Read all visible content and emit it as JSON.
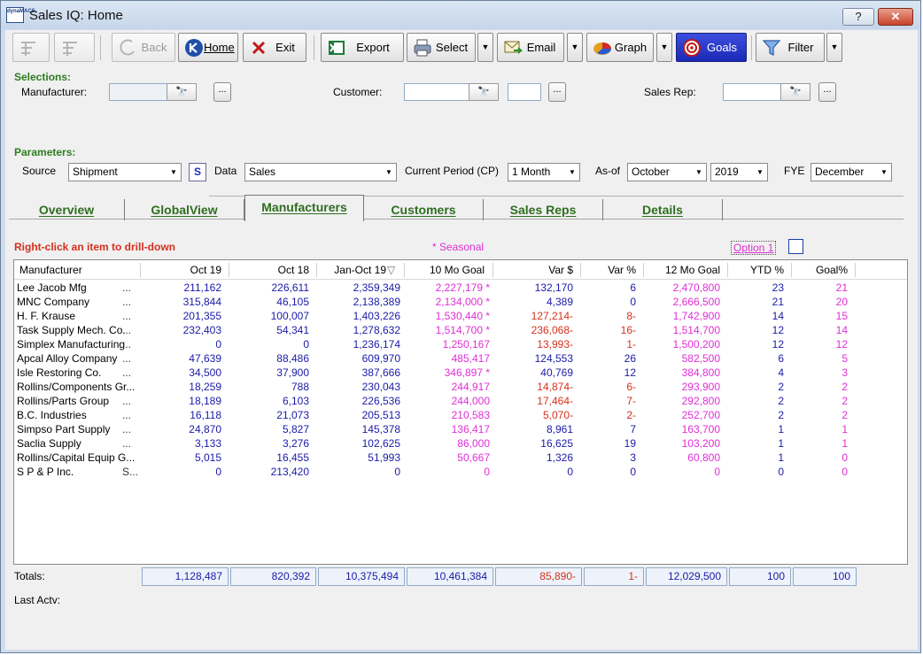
{
  "window": {
    "app_logo_text": "dynaMACS",
    "title": "Sales IQ: Home",
    "help_label": "?",
    "maximize_label": "▭",
    "close_label": "✕"
  },
  "toolbar": {
    "back": "Back",
    "home": "Home",
    "exit": "Exit",
    "export": "Export",
    "select": "Select",
    "email": "Email",
    "graph": "Graph",
    "goals": "Goals",
    "filter": "Filter",
    "dropdown_arrow": "▼"
  },
  "selections": {
    "heading": "Selections:",
    "manufacturer_label": "Manufacturer:",
    "customer_label": "Customer:",
    "sales_rep_label": "Sales Rep:",
    "dots_label": "...",
    "find_glyph": "🔭"
  },
  "parameters": {
    "heading": "Parameters:",
    "source_label": "Source",
    "source_value": "Shipment",
    "s_button": "S",
    "data_label": "Data",
    "data_value": "Sales",
    "current_period_label": "Current Period (CP)",
    "current_period_value": "1 Month",
    "asof_label": "As-of",
    "asof_month": "October",
    "asof_year": "2019",
    "fye_label": "FYE",
    "fye_value": "December",
    "dropdown_arrow": "▼"
  },
  "tabs": [
    {
      "label": "Overview"
    },
    {
      "label": "GlobalView"
    },
    {
      "label": "Manufacturers"
    },
    {
      "label": "Customers"
    },
    {
      "label": "Sales Reps"
    },
    {
      "label": "Details"
    }
  ],
  "hints": {
    "drill": "Right-click an item to drill-down",
    "seasonal": "* Seasonal",
    "option": "Option 1"
  },
  "grid": {
    "headers": [
      "Manufacturer",
      "Oct 19",
      "Oct 18",
      "Jan-Oct 19",
      "10 Mo Goal",
      "Var $",
      "Var %",
      "12 Mo Goal",
      "YTD %",
      "Goal%"
    ],
    "sort_indicator": "▽",
    "rows": [
      {
        "name": "Lee Jacob Mfg",
        "more": "...",
        "oct19": "211,162",
        "oct18": "226,611",
        "ytd": "2,359,349",
        "goal10": "2,227,179 *",
        "var": "132,170",
        "varpct": "6",
        "goal12": "2,470,800",
        "ytdpct": "23",
        "goalpct": "21",
        "neg": false
      },
      {
        "name": "MNC Company",
        "more": "...",
        "oct19": "315,844",
        "oct18": "46,105",
        "ytd": "2,138,389",
        "goal10": "2,134,000 *",
        "var": "4,389",
        "varpct": "0",
        "goal12": "2,666,500",
        "ytdpct": "21",
        "goalpct": "20",
        "neg": false
      },
      {
        "name": "H. F. Krause",
        "more": "...",
        "oct19": "201,355",
        "oct18": "100,007",
        "ytd": "1,403,226",
        "goal10": "1,530,440 *",
        "var": "127,214-",
        "varpct": "8-",
        "goal12": "1,742,900",
        "ytdpct": "14",
        "goalpct": "15",
        "neg": true
      },
      {
        "name": "Task Supply Mech. Co.",
        "more": "...",
        "oct19": "232,403",
        "oct18": "54,341",
        "ytd": "1,278,632",
        "goal10": "1,514,700 *",
        "var": "236,068-",
        "varpct": "16-",
        "goal12": "1,514,700",
        "ytdpct": "12",
        "goalpct": "14",
        "neg": true
      },
      {
        "name": "Simplex Manufacturing",
        "more": "...",
        "oct19": "0",
        "oct18": "0",
        "ytd": "1,236,174",
        "goal10": "1,250,167",
        "var": "13,993-",
        "varpct": "1-",
        "goal12": "1,500,200",
        "ytdpct": "12",
        "goalpct": "12",
        "neg": true
      },
      {
        "name": "Apcal Alloy Company",
        "more": "...",
        "oct19": "47,639",
        "oct18": "88,486",
        "ytd": "609,970",
        "goal10": "485,417",
        "var": "124,553",
        "varpct": "26",
        "goal12": "582,500",
        "ytdpct": "6",
        "goalpct": "5",
        "neg": false
      },
      {
        "name": "Isle Restoring Co.",
        "more": "...",
        "oct19": "34,500",
        "oct18": "37,900",
        "ytd": "387,666",
        "goal10": "346,897 *",
        "var": "40,769",
        "varpct": "12",
        "goal12": "384,800",
        "ytdpct": "4",
        "goalpct": "3",
        "neg": false
      },
      {
        "name": "Rollins/Components Gr...",
        "more": "",
        "oct19": "18,259",
        "oct18": "788",
        "ytd": "230,043",
        "goal10": "244,917",
        "var": "14,874-",
        "varpct": "6-",
        "goal12": "293,900",
        "ytdpct": "2",
        "goalpct": "2",
        "neg": true
      },
      {
        "name": "Rollins/Parts Group",
        "more": "...",
        "oct19": "18,189",
        "oct18": "6,103",
        "ytd": "226,536",
        "goal10": "244,000",
        "var": "17,464-",
        "varpct": "7-",
        "goal12": "292,800",
        "ytdpct": "2",
        "goalpct": "2",
        "neg": true
      },
      {
        "name": "B.C. Industries",
        "more": "...",
        "oct19": "16,118",
        "oct18": "21,073",
        "ytd": "205,513",
        "goal10": "210,583",
        "var": "5,070-",
        "varpct": "2-",
        "goal12": "252,700",
        "ytdpct": "2",
        "goalpct": "2",
        "neg": true
      },
      {
        "name": "Simpso Part Supply",
        "more": "...",
        "oct19": "24,870",
        "oct18": "5,827",
        "ytd": "145,378",
        "goal10": "136,417",
        "var": "8,961",
        "varpct": "7",
        "goal12": "163,700",
        "ytdpct": "1",
        "goalpct": "1",
        "neg": false
      },
      {
        "name": "Saclia Supply",
        "more": "...",
        "oct19": "3,133",
        "oct18": "3,276",
        "ytd": "102,625",
        "goal10": "86,000",
        "var": "16,625",
        "varpct": "19",
        "goal12": "103,200",
        "ytdpct": "1",
        "goalpct": "1",
        "neg": false
      },
      {
        "name": "Rollins/Capital Equip G...",
        "more": "",
        "oct19": "5,015",
        "oct18": "16,455",
        "ytd": "51,993",
        "goal10": "50,667",
        "var": "1,326",
        "varpct": "3",
        "goal12": "60,800",
        "ytdpct": "1",
        "goalpct": "0",
        "neg": false
      },
      {
        "name": "S P & P Inc.",
        "more": "S...",
        "oct19": "0",
        "oct18": "213,420",
        "ytd": "0",
        "goal10": "0",
        "var": "0",
        "varpct": "0",
        "goal12": "0",
        "ytdpct": "0",
        "goalpct": "0",
        "neg": false
      }
    ]
  },
  "totals": {
    "label": "Totals:",
    "oct19": "1,128,487",
    "oct18": "820,392",
    "ytd": "10,375,494",
    "goal10": "10,461,384",
    "var": "85,890-",
    "varpct": "1-",
    "goal12": "12,029,500",
    "ytdpct": "100",
    "goalpct": "100"
  },
  "footer": {
    "last_actv_label": "Last Actv:"
  }
}
